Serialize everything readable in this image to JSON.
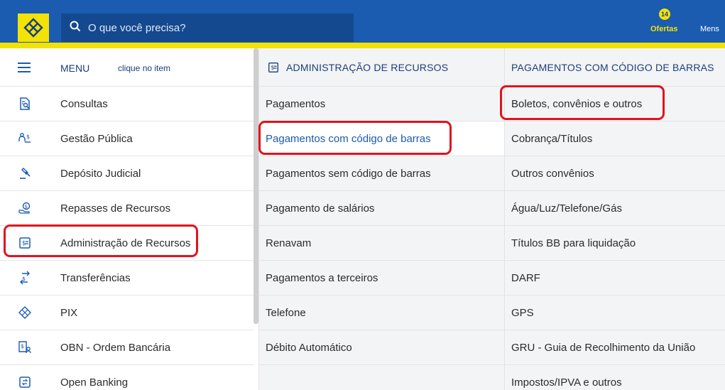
{
  "search": {
    "placeholder": "O que você precisa?"
  },
  "header": {
    "offers_badge": "14",
    "offers_label": "Ofertas",
    "messages_label": "Mens"
  },
  "menu": {
    "title": "MENU",
    "hint": "clique no item",
    "items": [
      {
        "label": "Consultas",
        "icon": "document-search-icon"
      },
      {
        "label": "Gestão Pública",
        "icon": "people-money-icon"
      },
      {
        "label": "Depósito Judicial",
        "icon": "gavel-icon"
      },
      {
        "label": "Repasses de Recursos",
        "icon": "hand-coin-icon"
      },
      {
        "label": "Administração de Recursos",
        "icon": "money-document-icon"
      },
      {
        "label": "Transferências",
        "icon": "transfer-arrows-icon"
      },
      {
        "label": "PIX",
        "icon": "pix-icon"
      },
      {
        "label": "OBN - Ordem Bancária",
        "icon": "bank-order-icon"
      },
      {
        "label": "Open Banking",
        "icon": "open-banking-icon"
      }
    ]
  },
  "column2": {
    "title": "ADMINISTRAÇÃO DE RECURSOS",
    "items": [
      "Pagamentos",
      "Pagamentos com código de barras",
      "Pagamentos sem código de barras",
      "Pagamento de salários",
      "Renavam",
      "Pagamentos a terceiros",
      "Telefone",
      "Débito Automático"
    ]
  },
  "column3": {
    "title": "PAGAMENTOS COM CÓDIGO DE BARRAS",
    "items": [
      "Boletos, convênios e outros",
      "Cobrança/Títulos",
      "Outros convênios",
      "Água/Luz/Telefone/Gás",
      "Títulos BB para liquidação",
      "DARF",
      "GPS",
      "GRU - Guia de Recolhimento da União",
      "Impostos/IPVA e outros"
    ]
  },
  "colors": {
    "brand_blue": "#1b5bb0",
    "brand_yellow": "#f2e206",
    "highlight_red": "#e0131d"
  }
}
